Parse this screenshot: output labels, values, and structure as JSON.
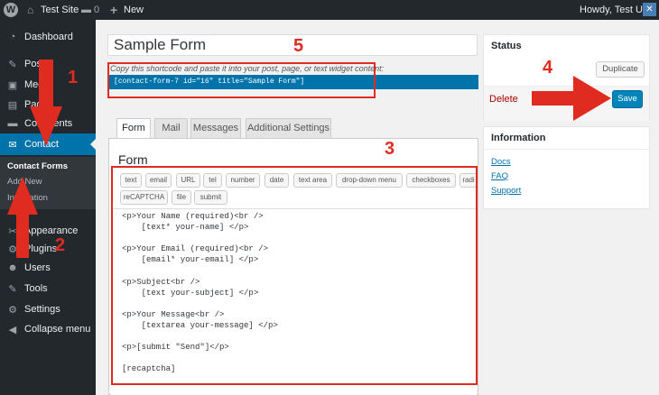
{
  "adminbar": {
    "site_name": "Test Site",
    "comment_count": "0",
    "new_label": "New",
    "howdy": "Howdy, Test User"
  },
  "sidebar": {
    "items": [
      {
        "label": "Dashboard",
        "icon": "dashboard-icon"
      },
      {
        "label": "Posts",
        "icon": "pin-icon"
      },
      {
        "label": "Media",
        "icon": "media-icon"
      },
      {
        "label": "Pages",
        "icon": "pages-icon"
      },
      {
        "label": "Comments",
        "icon": "comments-icon"
      },
      {
        "label": "Contact",
        "icon": "mail-icon"
      },
      {
        "label": "Appearance",
        "icon": "appearance-icon"
      },
      {
        "label": "Plugins",
        "icon": "plugins-icon"
      },
      {
        "label": "Users",
        "icon": "users-icon"
      },
      {
        "label": "Tools",
        "icon": "tools-icon"
      },
      {
        "label": "Settings",
        "icon": "settings-icon"
      },
      {
        "label": "Collapse menu",
        "icon": "collapse-icon"
      }
    ],
    "submenu": [
      "Contact Forms",
      "Add New",
      "Integration"
    ]
  },
  "form": {
    "title": "Sample Form",
    "shortcode_hint": "Copy this shortcode and paste it into your post, page, or text widget content:",
    "shortcode": "[contact-form-7 id=\"16\" title=\"Sample Form\"]"
  },
  "tabs": [
    "Form",
    "Mail",
    "Messages",
    "Additional Settings"
  ],
  "panel_heading": "Form",
  "tag_buttons_row1": [
    "text",
    "email",
    "URL",
    "tel",
    "number",
    "date",
    "text area",
    "drop-down menu",
    "checkboxes",
    "radi"
  ],
  "tag_buttons_row2": [
    "reCAPTCHA",
    "file",
    "submit"
  ],
  "form_code": [
    "<p>Your Name (required)<br />",
    "    [text* your-name] </p>",
    "",
    "<p>Your Email (required)<br />",
    "    [email* your-email] </p>",
    "",
    "<p>Subject<br />",
    "    [text your-subject] </p>",
    "",
    "<p>Your Message<br />",
    "    [textarea your-message] </p>",
    "",
    "<p>[submit \"Send\"]</p>",
    "",
    "[recaptcha]"
  ],
  "status": {
    "title": "Status",
    "duplicate": "Duplicate",
    "delete": "Delete",
    "save": "Save"
  },
  "information": {
    "title": "Information",
    "links": [
      "Docs",
      "FAQ",
      "Support"
    ]
  },
  "annotations": [
    "1",
    "2",
    "3",
    "4",
    "5"
  ],
  "colors": {
    "annotation": "#e02b20",
    "accent": "#0073aa",
    "sidebar": "#23282d"
  }
}
